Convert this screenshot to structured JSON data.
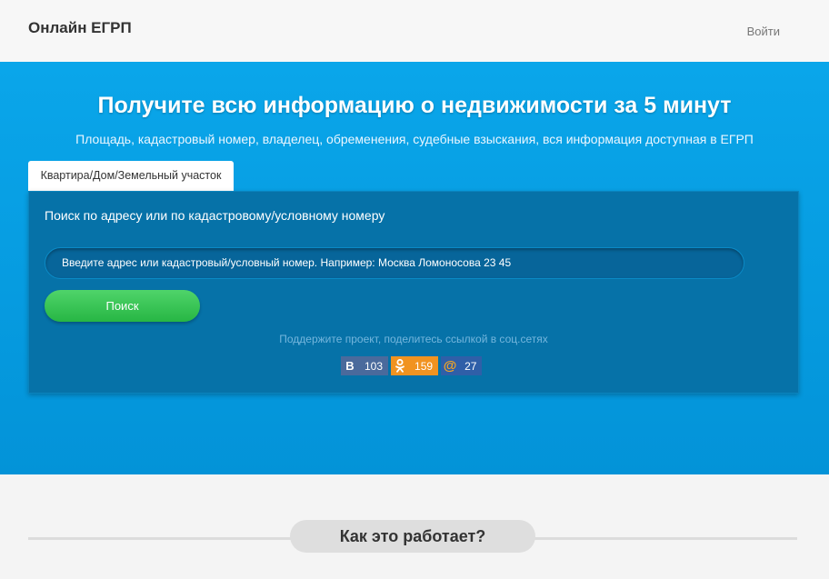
{
  "navbar": {
    "brand": "Онлайн ЕГРП",
    "login_label": "Войти"
  },
  "hero": {
    "title": "Получите всю информацию о недвижимости за 5 минут",
    "subtitle": "Площадь, кадастровый номер, владелец, обременения, судебные взыскания, вся информация доступная в ЕГРП"
  },
  "tabs": [
    {
      "label": "Квартира/Дом/Земельный участок",
      "active": true
    }
  ],
  "search": {
    "title": "Поиск по адресу или по кадастровому/условному номеру",
    "placeholder": "Введите адрес или кадастровый/условный номер. Например: Москва Ломоносова 23 45",
    "button_label": "Поиск"
  },
  "share": {
    "text": "Поддержите проект, поделитесь ссылкой в соц.сетях",
    "buttons": [
      {
        "network": "vk",
        "icon": "vk-icon",
        "glyph": "В",
        "count": "103",
        "color": "#4a6a9c"
      },
      {
        "network": "odnoklassniki",
        "icon": "odnoklassniki-icon",
        "glyph": "ок",
        "count": "159",
        "color": "#f19320"
      },
      {
        "network": "mail",
        "icon": "mail-ru-icon",
        "glyph": "@",
        "count": "27",
        "color": "#2f5fa8"
      }
    ]
  },
  "how_it_works": {
    "title": "Как это работает?"
  },
  "colors": {
    "hero_bg": "#0aa6ea",
    "panel_bg": "#0672a8",
    "button_green": "#27b644"
  }
}
